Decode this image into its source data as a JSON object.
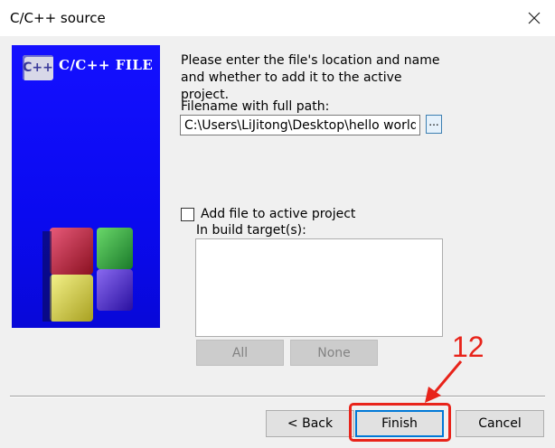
{
  "window": {
    "title": "C/C++ source"
  },
  "banner": {
    "logo_text": "C++",
    "heading": "C/C++ FILE"
  },
  "content": {
    "description": "Please enter the file's location and name and whether to add it to the active project.",
    "filename_label": "Filename with full path:",
    "filename_value": "C:\\Users\\LiJitong\\Desktop\\hello world.c",
    "browse_label": "...",
    "add_to_project_label": "Add file to active project",
    "add_to_project_checked": false,
    "build_targets_label": "In build target(s):",
    "all_label": "All",
    "none_label": "None"
  },
  "footer": {
    "back_label": "< Back",
    "finish_label": "Finish",
    "cancel_label": "Cancel"
  },
  "annotation": {
    "step_number": "12"
  }
}
